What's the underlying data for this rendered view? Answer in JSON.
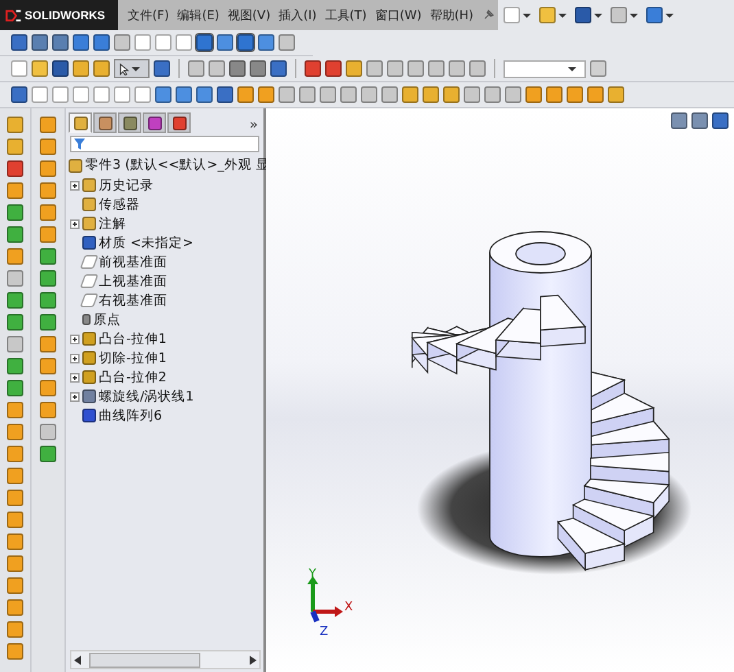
{
  "app": {
    "logo": "SOLIDWORKS"
  },
  "menu": [
    "文件(F)",
    "编辑(E)",
    "视图(V)",
    "插入(I)",
    "工具(T)",
    "窗口(W)",
    "帮助(H)"
  ],
  "panel_tabs": [
    {
      "kind": "features",
      "selected": true
    },
    {
      "kind": "properties",
      "selected": false
    },
    {
      "kind": "configurations",
      "selected": false
    },
    {
      "kind": "dimxpert",
      "selected": false
    },
    {
      "kind": "display",
      "selected": false
    }
  ],
  "panel_more": "»",
  "tree": {
    "root": "零件3  (默认<<默认>_外观 显",
    "items": [
      {
        "label": "历史记录",
        "kind": "history",
        "collapsed": true
      },
      {
        "label": "传感器",
        "kind": "sensor",
        "collapsed": false
      },
      {
        "label": "注解",
        "kind": "annotation",
        "collapsed": true
      },
      {
        "label": "材质 <未指定>",
        "kind": "material",
        "collapsed": false
      },
      {
        "label": "前视基准面",
        "kind": "plane",
        "collapsed": false
      },
      {
        "label": "上视基准面",
        "kind": "plane",
        "collapsed": false
      },
      {
        "label": "右视基准面",
        "kind": "plane",
        "collapsed": false
      },
      {
        "label": "原点",
        "kind": "origin",
        "collapsed": false
      },
      {
        "label": "凸台-拉伸1",
        "kind": "boss",
        "collapsed": true
      },
      {
        "label": "切除-拉伸1",
        "kind": "cut",
        "collapsed": true
      },
      {
        "label": "凸台-拉伸2",
        "kind": "boss",
        "collapsed": true
      },
      {
        "label": "螺旋线/涡状线1",
        "kind": "helix",
        "collapsed": true
      },
      {
        "label": "曲线阵列6",
        "kind": "pattern",
        "collapsed": false
      }
    ]
  },
  "triad": {
    "x": "X",
    "y": "Y",
    "z": "Z"
  }
}
